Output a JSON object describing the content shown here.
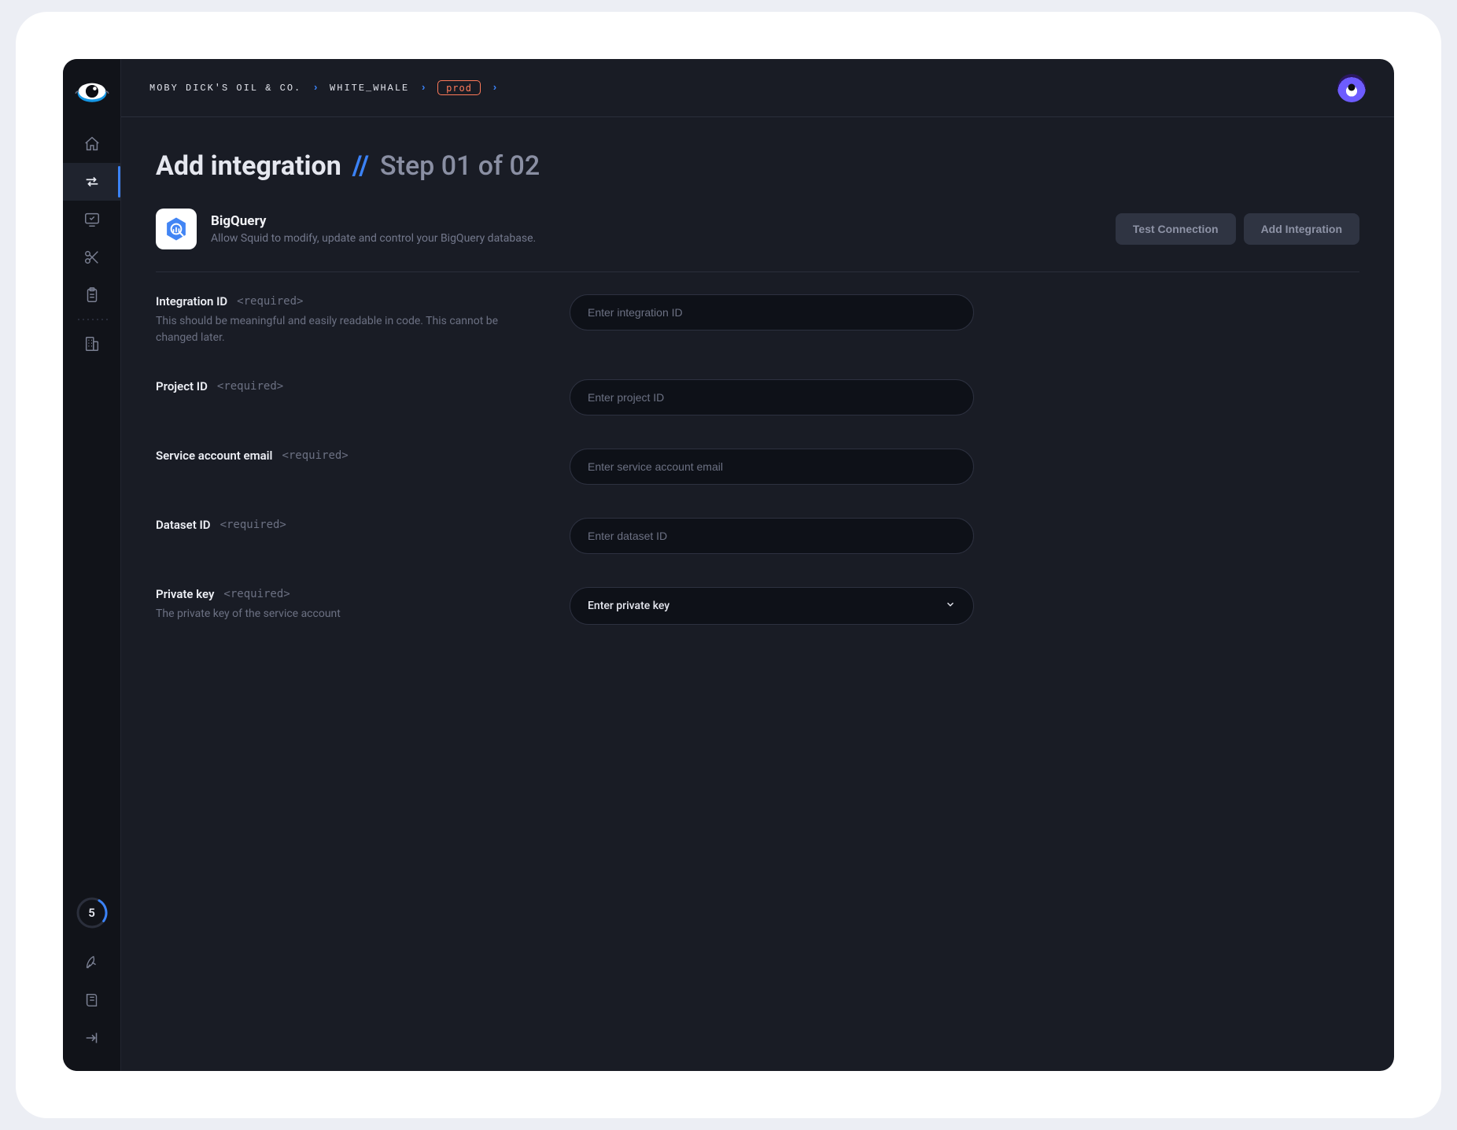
{
  "breadcrumbs": {
    "org": "MOBY DICK'S OIL & CO.",
    "project": "WHITE_WHALE",
    "env": "prod"
  },
  "page": {
    "title": "Add integration",
    "slashes": "//",
    "step": "Step 01 of 02"
  },
  "integration": {
    "name": "BigQuery",
    "description": "Allow Squid to modify, update and control your BigQuery database."
  },
  "actions": {
    "test": "Test Connection",
    "add": "Add Integration"
  },
  "required_tag": "<required>",
  "fields": {
    "integration_id": {
      "label": "Integration ID",
      "desc": "This should be meaningful and easily readable in code. This cannot be changed later.",
      "placeholder": "Enter integration ID"
    },
    "project_id": {
      "label": "Project ID",
      "placeholder": "Enter project ID"
    },
    "service_account_email": {
      "label": "Service account email",
      "placeholder": "Enter service account email"
    },
    "dataset_id": {
      "label": "Dataset ID",
      "placeholder": "Enter dataset ID"
    },
    "private_key": {
      "label": "Private key",
      "desc": "The private key of the service account",
      "placeholder": "Enter private key"
    }
  },
  "sidebar": {
    "usage_value": "5"
  }
}
